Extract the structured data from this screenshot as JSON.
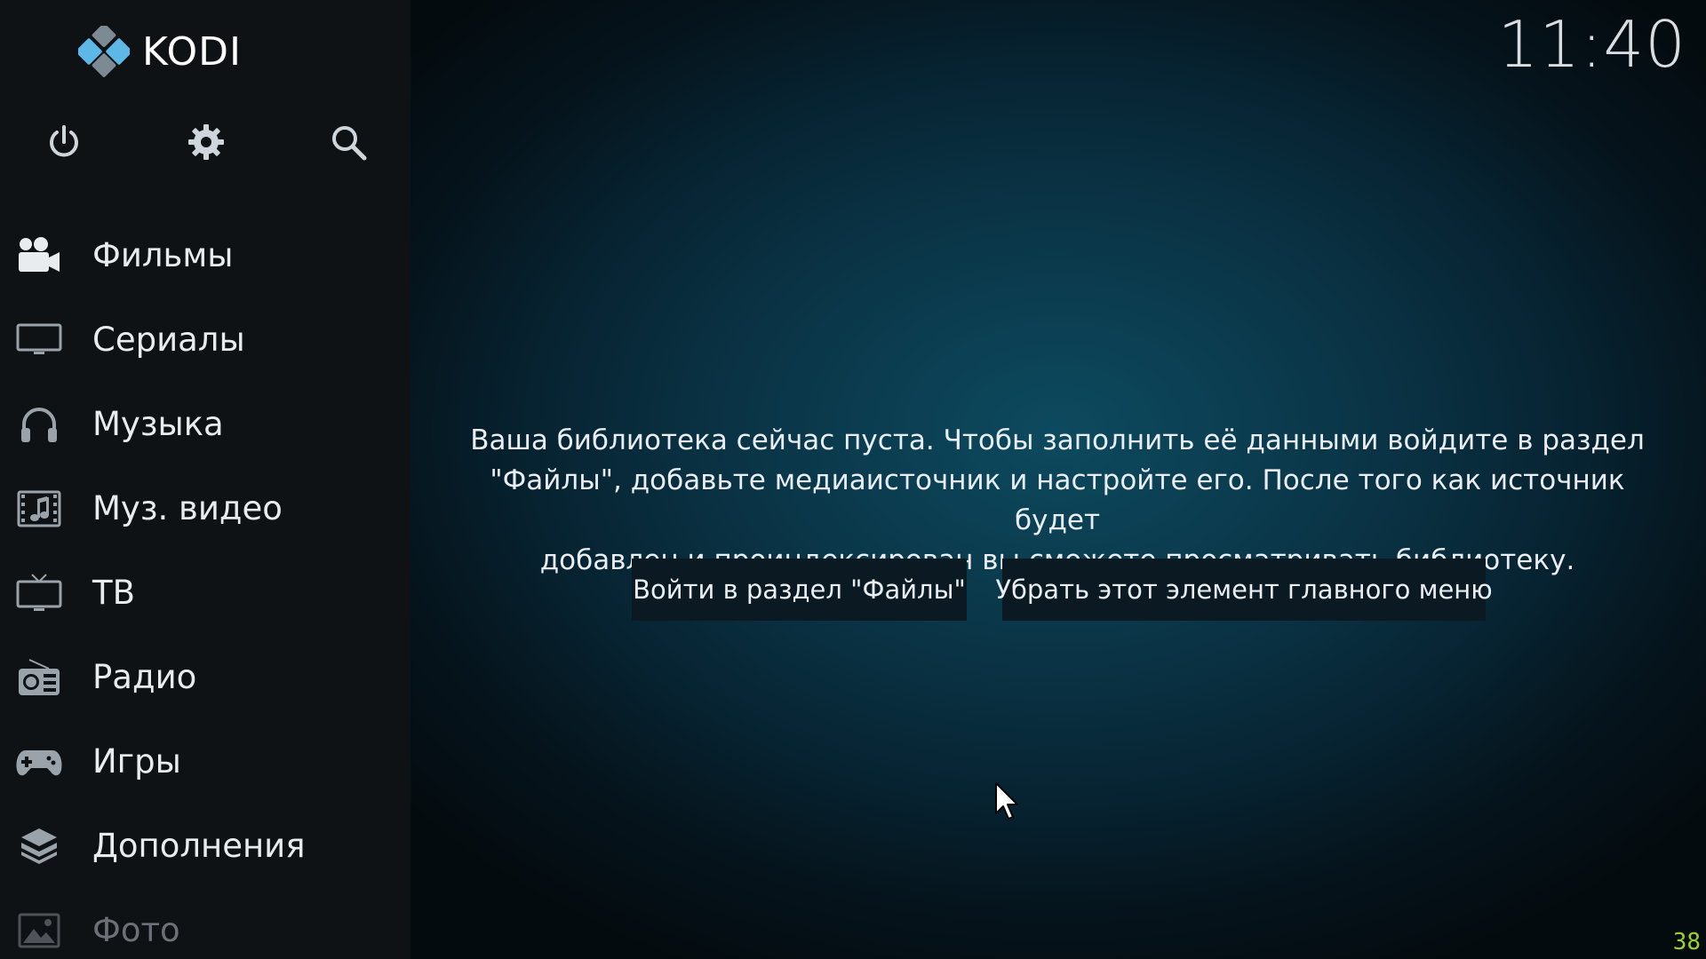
{
  "app": {
    "logo_text": "KODI",
    "clock": "11:40",
    "fps": "38"
  },
  "top_icons": [
    {
      "name": "power-icon"
    },
    {
      "name": "gear-icon"
    },
    {
      "name": "search-icon"
    }
  ],
  "menu": {
    "items": [
      {
        "label": "Фильмы",
        "icon": "movies-icon"
      },
      {
        "label": "Сериалы",
        "icon": "tv-shows-icon"
      },
      {
        "label": "Музыка",
        "icon": "headphones-icon"
      },
      {
        "label": "Муз. видео",
        "icon": "music-video-icon"
      },
      {
        "label": "ТВ",
        "icon": "tv-icon"
      },
      {
        "label": "Радио",
        "icon": "radio-icon"
      },
      {
        "label": "Игры",
        "icon": "gamepad-icon"
      },
      {
        "label": "Дополнения",
        "icon": "addons-icon"
      },
      {
        "label": "Фото",
        "icon": "pictures-icon"
      }
    ]
  },
  "main": {
    "message_lines": [
      "Ваша библиотека сейчас пуста. Чтобы заполнить её данными войдите в раздел",
      "\"Файлы\", добавьте медиаисточник и настройте его. После того как источник будет",
      "добавлен и проиндексирован вы сможете просматривать библиотеку."
    ],
    "buttons": {
      "files": "Войти в раздел \"Файлы\"",
      "remove": "Убрать этот элемент главного меню"
    }
  },
  "colors": {
    "sidebar_bg": "#0f1215",
    "button_bg": "#0b1a22",
    "fps_color": "#9bd12c",
    "kodi_logo_blue": "#5db8e6"
  }
}
